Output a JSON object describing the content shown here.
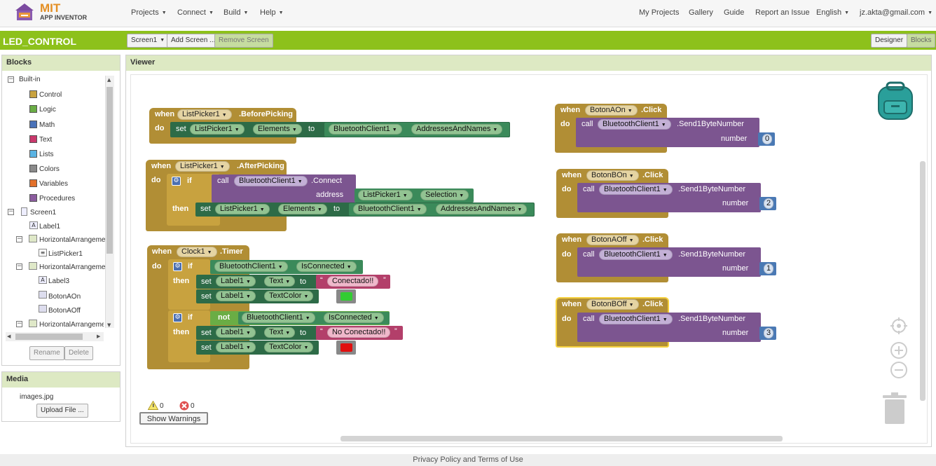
{
  "header": {
    "logo_mit": "MIT",
    "logo_sub": "APP INVENTOR",
    "menus": [
      "Projects",
      "Connect",
      "Build",
      "Help"
    ],
    "links": [
      "My Projects",
      "Gallery",
      "Guide",
      "Report an Issue",
      "English",
      "jz.akta@gmail.com"
    ]
  },
  "projectbar": {
    "project_name": "LED_CONTROL",
    "screen_select": "Screen1",
    "add_screen": "Add Screen ...",
    "remove_screen": "Remove Screen",
    "designer": "Designer",
    "blocks": "Blocks"
  },
  "blocks_panel": {
    "title": "Blocks",
    "builtin_label": "Built-in",
    "builtin": [
      {
        "label": "Control",
        "color": "#c8a23f"
      },
      {
        "label": "Logic",
        "color": "#6aad45"
      },
      {
        "label": "Math",
        "color": "#4a72b8"
      },
      {
        "label": "Text",
        "color": "#c9386c"
      },
      {
        "label": "Lists",
        "color": "#5ab3e3"
      },
      {
        "label": "Colors",
        "color": "#8a8a8a"
      },
      {
        "label": "Variables",
        "color": "#e2702a"
      },
      {
        "label": "Procedures",
        "color": "#8b5c9e"
      }
    ],
    "components": [
      "Screen1",
      "Label1",
      "HorizontalArrangeme",
      "ListPicker1",
      "HorizontalArrangeme",
      "Label3",
      "BotonAOn",
      "BotonAOff",
      "HorizontalArrangeme"
    ],
    "rename": "Rename",
    "delete": "Delete"
  },
  "media_panel": {
    "title": "Media",
    "file": "images.jpg",
    "upload": "Upload File ..."
  },
  "viewer": {
    "title": "Viewer",
    "warnings_count": "0",
    "errors_count": "0",
    "show_warnings": "Show Warnings"
  },
  "blocks": {
    "when": "when",
    "do": "do",
    "set": "set",
    "to": "to",
    "call": "call",
    "if": "if",
    "then": "then",
    "not": "not",
    "address": "address",
    "number": "number",
    "ev_before": ".BeforePicking",
    "ev_after": ".AfterPicking",
    "ev_timer": ".Timer",
    "ev_click": ".Click",
    "connect": ".Connect",
    "send": ".Send1ByteNumber",
    "listpicker": "ListPicker1",
    "bt": "BluetoothClient1",
    "clock": "Clock1",
    "label": "Label1",
    "elements": "Elements",
    "addresses": "AddressesAndNames",
    "selection": "Selection",
    "isconnected": "IsConnected",
    "text": "Text",
    "textcolor": "TextColor",
    "str_connected": "Conectado!!",
    "str_notconnected": "No Conectado!!",
    "color_green": "#33cc33",
    "color_red": "#e01010",
    "btn_aon": "BotonAOn",
    "btn_bon": "BotonBOn",
    "btn_aoff": "BotonAOff",
    "btn_boff": "BotonBOff",
    "n0": "0",
    "n2": "2",
    "n1": "1",
    "n3": "3"
  },
  "footer": {
    "text": "Privacy Policy and Terms of Use"
  }
}
